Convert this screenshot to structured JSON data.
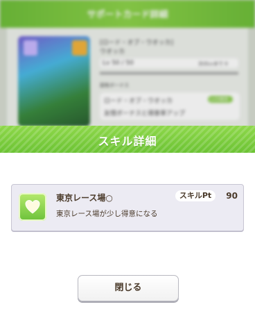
{
  "background": {
    "title": "サポートカード詳細",
    "card_name_line1": "[ロード・オブ・ウオッカ]",
    "card_name_line2": "ウオッカ",
    "level": "Lv 50 / 50",
    "level_note": "次のLvまで 0",
    "section_label": "固有ボーナス",
    "bonus_name": "ロード・オブ・ウオッカ",
    "bonus_desc": "友情ボーナスと得意率アップ",
    "bonus_tag": "Lv30解放"
  },
  "modal": {
    "title": "スキル詳細",
    "skill": {
      "name": "東京レース場○",
      "pt_label": "スキルPt",
      "pt_value": "90",
      "description": "東京レース場が少し得意になる",
      "icon": "heart-icon"
    },
    "close_label": "閉じる"
  },
  "colors": {
    "header_green": "#6cc334",
    "text_brown": "#4a3a2a",
    "row_bg": "#ecebf3"
  }
}
